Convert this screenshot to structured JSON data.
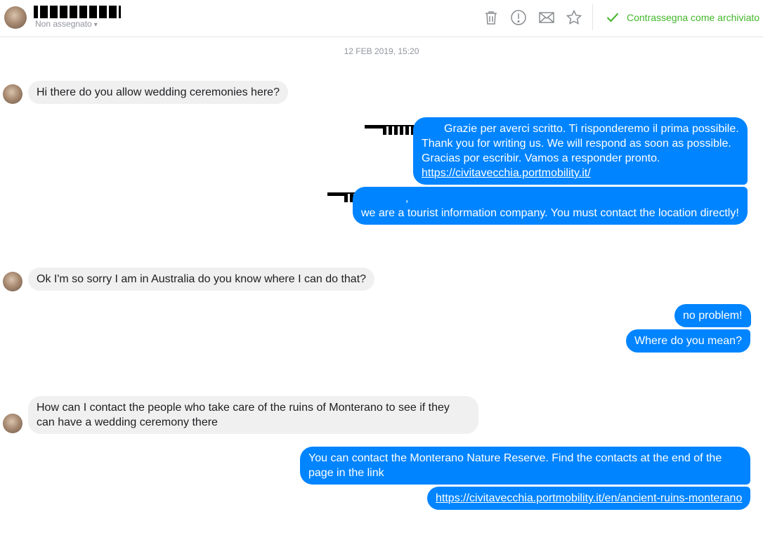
{
  "header": {
    "status": "Non assegnato",
    "archive_label": "Contrassegna come archiviato"
  },
  "toolbar": {
    "icons": [
      "trash-icon",
      "alert-icon",
      "envelope-icon",
      "star-icon",
      "checkmark-icon"
    ]
  },
  "conversation": {
    "timestamp": "12 FEB 2019, 15:20",
    "messages": [
      {
        "side": "in",
        "lines": [
          "Hi there do you allow wedding ceremonies here?"
        ]
      },
      {
        "side": "out",
        "lines": [
          "Grazie per averci scritto. Ti risponderemo il prima possibile.",
          "Thank you for writing us. We will respond as soon as possible.",
          "Gracias por escribir. Vamos a responder pronto.",
          "https://civitavecchia.portmobility.it/"
        ]
      },
      {
        "side": "out",
        "lines": [
          ",",
          "we are a  tourist information company. You must contact the location directly!"
        ]
      },
      {
        "side": "in",
        "lines": [
          "Ok I'm so sorry I am in Australia do you know where I can do that?"
        ]
      },
      {
        "side": "out",
        "lines": [
          "no problem!"
        ]
      },
      {
        "side": "out",
        "lines": [
          "Where do you mean?"
        ]
      },
      {
        "side": "in",
        "lines": [
          "How can I contact the people who take care of the ruins of Monterano to see if they",
          "can have a wedding ceremony there"
        ]
      },
      {
        "side": "out",
        "lines": [
          "You can contact the Monterano Nature Reserve. Find the contacts at the end of the",
          "page in the link"
        ]
      },
      {
        "side": "out",
        "lines": [
          "https://civitavecchia.portmobility.it/en/ancient-ruins-monterano"
        ]
      }
    ]
  },
  "colors": {
    "outgoing": "#0084ff",
    "incoming": "#f1f0f0",
    "archive": "#42b72a",
    "meta": "#90949c"
  }
}
